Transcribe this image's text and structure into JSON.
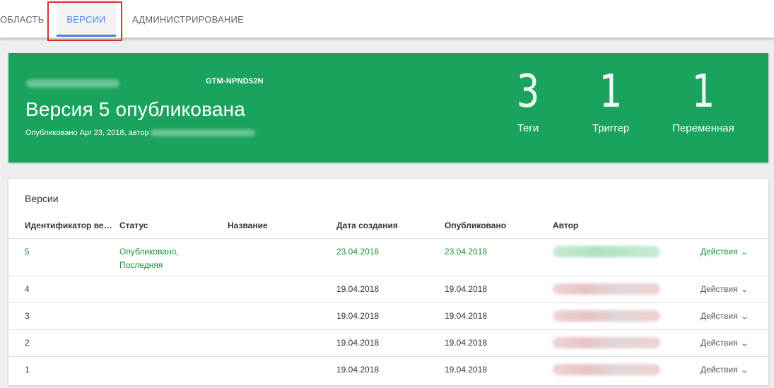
{
  "tabs": [
    {
      "label": "ОБЛАСТЬ",
      "active": false
    },
    {
      "label": "ВЕРСИИ",
      "active": true
    },
    {
      "label": "АДМИНИСТРИРОВАНИЕ",
      "active": false
    }
  ],
  "banner": {
    "container_id": "GTM-NPND52N",
    "title": "Версия 5 опубликована",
    "published_prefix": "Опубликовано Apr 23, 2018, автор",
    "stats": [
      {
        "value": "3",
        "label": "Теги"
      },
      {
        "value": "1",
        "label": "Триггер"
      },
      {
        "value": "1",
        "label": "Переменная"
      }
    ],
    "color": "#1aa35c"
  },
  "versions": {
    "title": "Версии",
    "columns": [
      "Идентификатор вер…",
      "Статус",
      "Название",
      "Дата создания",
      "Опубликовано",
      "Автор"
    ],
    "rows": [
      {
        "id": "5",
        "status": "Опубликовано, Последняя",
        "name": "",
        "created": "23.04.2018",
        "published": "23.04.2018",
        "action": "Действия"
      },
      {
        "id": "4",
        "status": "",
        "name": "",
        "created": "19.04.2018",
        "published": "19.04.2018",
        "action": "Действия"
      },
      {
        "id": "3",
        "status": "",
        "name": "",
        "created": "19.04.2018",
        "published": "19.04.2018",
        "action": "Действия"
      },
      {
        "id": "2",
        "status": "",
        "name": "",
        "created": "19.04.2018",
        "published": "19.04.2018",
        "action": "Действия"
      },
      {
        "id": "1",
        "status": "",
        "name": "",
        "created": "19.04.2018",
        "published": "19.04.2018",
        "action": "Действия"
      }
    ]
  },
  "colors": {
    "accent": "#4a86e8",
    "live": "#1e8e3e",
    "highlight": "#d93025"
  }
}
